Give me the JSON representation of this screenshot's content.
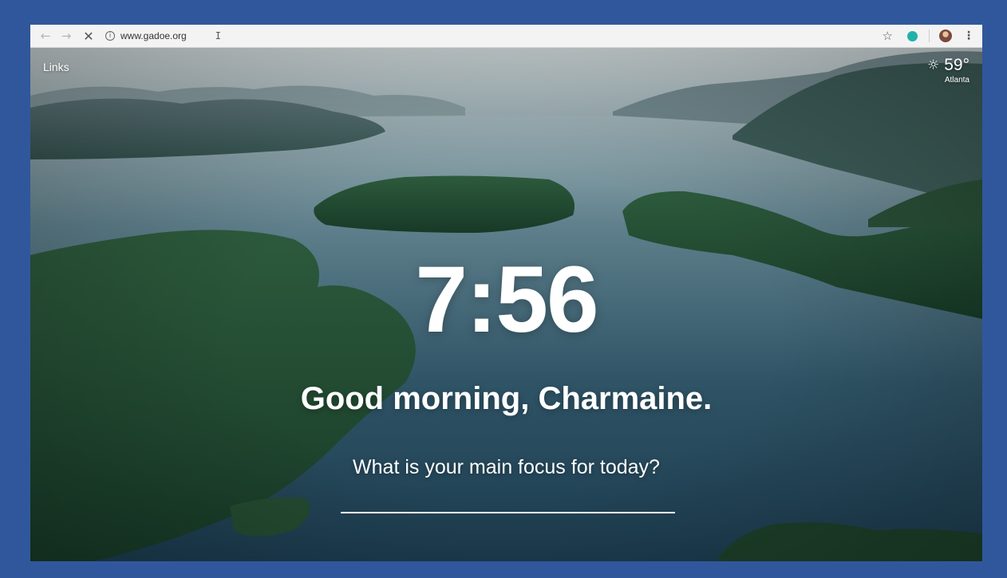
{
  "browser": {
    "url": "www.gadoe.org",
    "icons": {
      "back": "back-arrow-icon",
      "forward": "forward-arrow-icon",
      "stop": "stop-loading-icon",
      "info": "site-info-icon",
      "bookmark": "bookmark-star-icon",
      "extension": "extension-icon",
      "profile": "profile-avatar",
      "menu": "menu-dots-icon"
    },
    "glyphs": {
      "back": "←",
      "forward": "→",
      "stop": "✕",
      "info": "i",
      "bookmark": "☆",
      "menu": "⋮",
      "cursor": "I"
    }
  },
  "dashboard": {
    "links_label": "Links",
    "weather": {
      "icon": "sun-icon",
      "glyph": "☼",
      "temperature": "59°",
      "city": "Atlanta"
    },
    "time": "7:56",
    "greeting": "Good morning, Charmaine.",
    "focus_question": "What is your main focus for today?",
    "focus_value": ""
  },
  "colors": {
    "outer_background": "#30579c",
    "text": "#ffffff",
    "extension_accent": "#20b2aa"
  }
}
